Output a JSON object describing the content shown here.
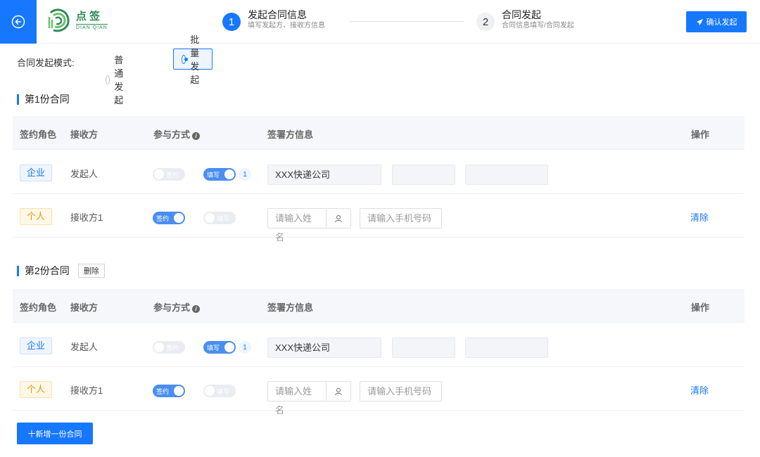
{
  "header": {
    "back_icon": "arrow-left-circle-icon",
    "logo": {
      "cn": "点签",
      "en": "DIAN QIAN"
    },
    "steps": [
      {
        "num": "1",
        "title": "发起合同信息",
        "sub": "填写发起方、接收方信息"
      },
      {
        "num": "2",
        "title": "合同发起",
        "sub": "合同信息填写/合同发起"
      }
    ],
    "confirm_label": "确认发起",
    "accent": "#1677ff"
  },
  "mode": {
    "label": "合同发起模式:",
    "options": [
      "普通发起",
      "批量发起"
    ],
    "selected": "批量发起"
  },
  "table_headers": {
    "role": "签约角色",
    "party": "接收方",
    "method": "参与方式",
    "info": "签署方信息",
    "action": "操作"
  },
  "contracts": [
    {
      "title": "第1份合同",
      "rows": [
        {
          "role": "企业",
          "party": "发起人",
          "sign": "签约",
          "fill": "填写",
          "count": "1",
          "company": "XXX快递公司"
        },
        {
          "role": "个人",
          "party": "接收方1",
          "sign": "签约",
          "fill": "填写",
          "name_placeholder": "请输入姓名",
          "phone_placeholder": "请输入手机号码",
          "action": "清除"
        }
      ]
    },
    {
      "title": "第2份合同",
      "delete_label": "删除",
      "rows": [
        {
          "role": "企业",
          "party": "发起人",
          "sign": "签约",
          "fill": "填写",
          "count": "1",
          "company": "XXX快递公司"
        },
        {
          "role": "个人",
          "party": "接收方1",
          "sign": "签约",
          "fill": "填写",
          "name_placeholder": "请输入姓名",
          "phone_placeholder": "请输入手机号码",
          "action": "清除"
        }
      ]
    }
  ],
  "add_label": "十新增一份合同"
}
